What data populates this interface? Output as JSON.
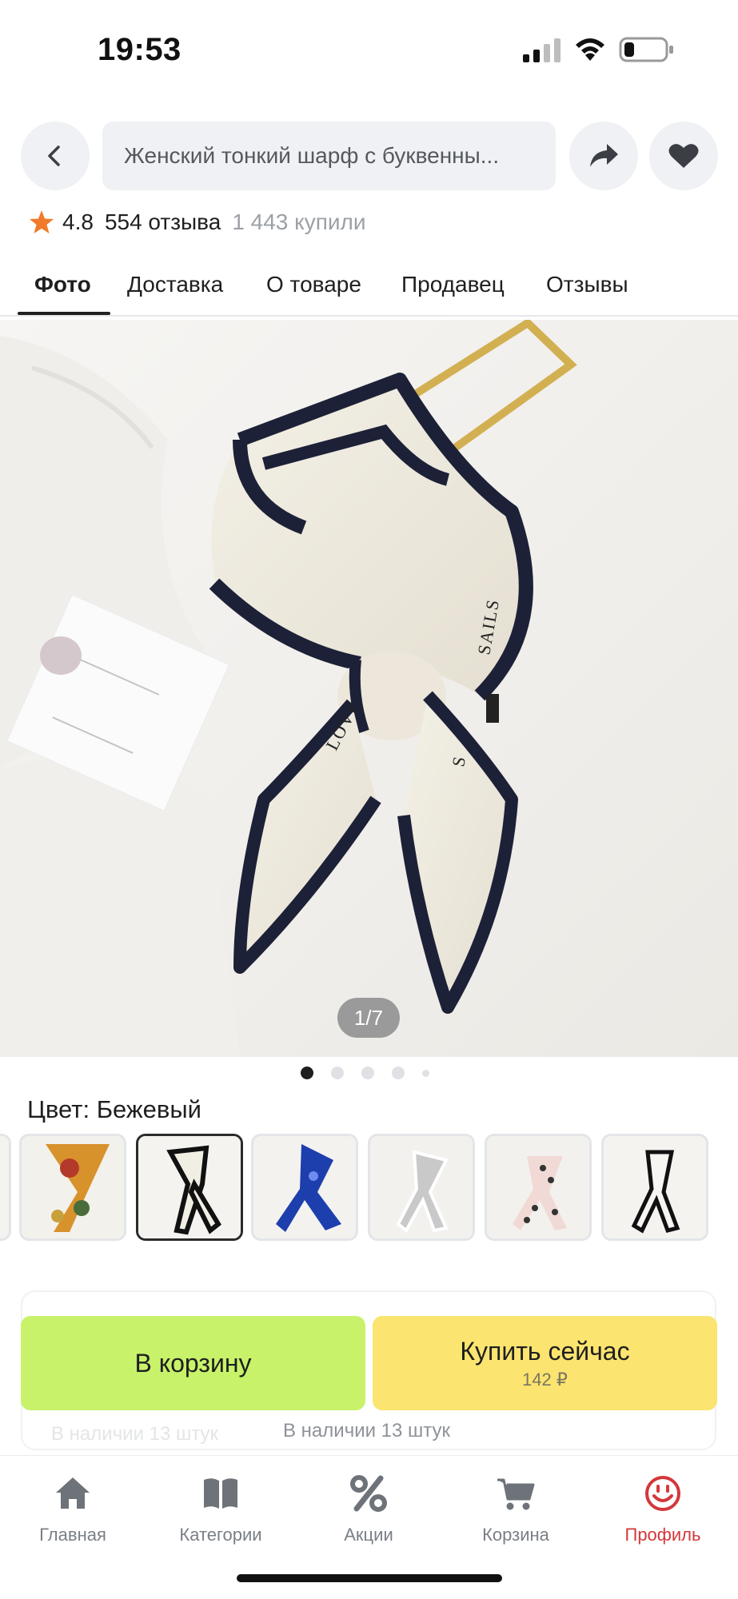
{
  "status_bar": {
    "time": "19:53"
  },
  "header": {
    "search_text": "Женский тонкий шарф с буквенны..."
  },
  "rating": {
    "score": "4.8",
    "reviews": "554 отзыва",
    "bought": "1 443 купили"
  },
  "tabs": [
    {
      "label": "Фото",
      "active": true
    },
    {
      "label": "Доставка"
    },
    {
      "label": "О товаре"
    },
    {
      "label": "Продавец"
    },
    {
      "label": "Отзывы"
    }
  ],
  "gallery": {
    "counter": "1/7",
    "image_text_left": "LOVE",
    "image_text_right": "SAILS",
    "image_text_bottom": "S"
  },
  "variant": {
    "color_label": "Цвет: Бежевый",
    "thumbnails": [
      {
        "name": "floral-multicolor"
      },
      {
        "name": "beige-black-border",
        "selected": true
      },
      {
        "name": "blue-pattern"
      },
      {
        "name": "grey-white"
      },
      {
        "name": "pink-polka-dot"
      },
      {
        "name": "white-black-stripe"
      }
    ]
  },
  "actions": {
    "cart_label": "В корзину",
    "buy_label": "Купить сейчас",
    "buy_price": "142 ₽",
    "stock_faded": "В наличии 13 штук",
    "stock_text": "В наличии 13 штук"
  },
  "bottom_nav": [
    {
      "label": "Главная",
      "icon": "home-icon"
    },
    {
      "label": "Категории",
      "icon": "book-icon"
    },
    {
      "label": "Акции",
      "icon": "percent-icon"
    },
    {
      "label": "Корзина",
      "icon": "cart-icon"
    },
    {
      "label": "Профиль",
      "icon": "smile-icon",
      "active": true
    }
  ],
  "colors": {
    "cart_button": "#c8f26a",
    "buy_button": "#fbe46f",
    "rating_star": "#f07a2a",
    "active_nav": "#d4373a"
  }
}
